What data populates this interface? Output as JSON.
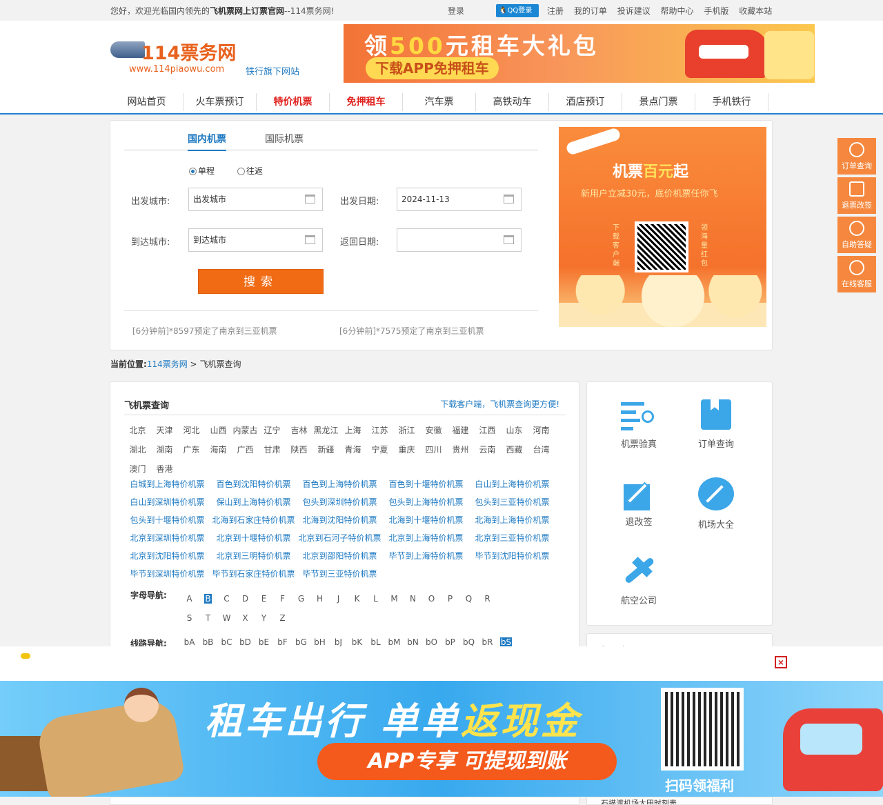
{
  "topbar": {
    "welcome_prefix": "您好，欢迎光临国内领先的",
    "welcome_bold": "飞机票网上订票官网",
    "welcome_suffix": "--114票务网!",
    "login": "登录",
    "qq_login": "QQ登录",
    "links": [
      "注册",
      "我的订单",
      "投诉建议",
      "帮助中心",
      "手机版",
      "收藏本站"
    ]
  },
  "header": {
    "logo_name": "114票务网",
    "logo_url": "www.114piaowu.com",
    "logo_flag": "铁行旗下网站",
    "banner_line1_a": "领",
    "banner_line1_num": "500",
    "banner_line1_b": "元租车大礼包",
    "banner_line2": "下载APP免押租车"
  },
  "nav": [
    {
      "label": "网站首页",
      "red": false
    },
    {
      "label": "火车票预订",
      "red": false
    },
    {
      "label": "特价机票",
      "red": true
    },
    {
      "label": "免押租车",
      "red": true
    },
    {
      "label": "汽车票",
      "red": false
    },
    {
      "label": "高铁动车",
      "red": false
    },
    {
      "label": "酒店预订",
      "red": false
    },
    {
      "label": "景点门票",
      "red": false
    },
    {
      "label": "手机铁行",
      "red": false
    }
  ],
  "search": {
    "tab_domestic": "国内机票",
    "tab_international": "国际机票",
    "radio_oneway": "单程",
    "radio_roundtrip": "往返",
    "from_label": "出发城市:",
    "from_value": "出发城市",
    "to_label": "到达城市:",
    "to_value": "到达城市",
    "depart_label": "出发日期:",
    "depart_value": "2024-11-13",
    "return_label": "返回日期:",
    "return_value": "",
    "button": "搜索",
    "recent": [
      "[6分钟前]*8597预定了南京到三亚机票",
      "[6分钟前]*7575预定了南京到三亚机票"
    ]
  },
  "promo": {
    "line1_a": "机票",
    "line1_b": "百元",
    "line1_c": "起",
    "line2": "新用户立减30元，底价机票任你飞",
    "left_vertical": "下载客户端",
    "right_vertical": "领海量红包"
  },
  "breadcrumb": {
    "label": "当前位置:",
    "home": "114票务网",
    "sep": ">",
    "current": "飞机票查询"
  },
  "main": {
    "title": "飞机票查询",
    "download": "下载客户端，飞机票查询更方便!",
    "provinces": [
      "北京",
      "天津",
      "河北",
      "山西",
      "内蒙古",
      "辽宁",
      "吉林",
      "黑龙江",
      "上海",
      "江苏",
      "浙江",
      "安徽",
      "福建",
      "江西",
      "山东",
      "河南",
      "湖北",
      "湖南",
      "广东",
      "海南",
      "广西",
      "甘肃",
      "陕西",
      "新疆",
      "青海",
      "宁夏",
      "重庆",
      "四川",
      "贵州",
      "云南",
      "西藏",
      "台湾",
      "澳门",
      "香港"
    ],
    "routes": [
      "白城到上海特价机票",
      "百色到沈阳特价机票",
      "百色到上海特价机票",
      "百色到十堰特价机票",
      "白山到上海特价机票",
      "白山到深圳特价机票",
      "保山到上海特价机票",
      "包头到深圳特价机票",
      "包头到上海特价机票",
      "包头到三亚特价机票",
      "包头到十堰特价机票",
      "北海到石家庄特价机票",
      "北海到沈阳特价机票",
      "北海到十堰特价机票",
      "北海到上海特价机票",
      "北京到深圳特价机票",
      "北京到十堰特价机票",
      "北京到石河子特价机票",
      "北京到上海特价机票",
      "北京到三亚特价机票",
      "北京到沈阳特价机票",
      "北京到三明特价机票",
      "北京到邵阳特价机票",
      "毕节到上海特价机票",
      "毕节到沈阳特价机票",
      "毕节到深圳特价机票",
      "毕节到石家庄特价机票",
      "毕节到三亚特价机票"
    ],
    "letters_label": "字母导航:",
    "letters": [
      "A",
      "B",
      "C",
      "D",
      "E",
      "F",
      "G",
      "H",
      "J",
      "K",
      "L",
      "M",
      "N",
      "O",
      "P",
      "Q",
      "R",
      "S",
      "T",
      "W",
      "X",
      "Y",
      "Z"
    ],
    "letters_selected": "B",
    "lines_label": "线路导航:",
    "lines": [
      "bA",
      "bB",
      "bC",
      "bD",
      "bE",
      "bF",
      "bG",
      "bH",
      "bJ",
      "bK",
      "bL",
      "bM",
      "bN",
      "bO",
      "bP",
      "bQ",
      "bR",
      "bS"
    ],
    "lines_selected": "bS"
  },
  "services": [
    {
      "label": "机票验真",
      "icon": "ticket-verify-icon"
    },
    {
      "label": "订单查询",
      "icon": "order-book-icon"
    },
    {
      "label": "退改签",
      "icon": "edit-icon"
    },
    {
      "label": "机场大全",
      "icon": "compass-icon"
    },
    {
      "label": "航空公司",
      "icon": "airplane-icon"
    }
  ],
  "side_info": {
    "title": "机票资讯",
    "last_item": "石描渡机场大田时刻表"
  },
  "float_menu": [
    {
      "label": "订单查询",
      "icon": "search-icon"
    },
    {
      "label": "退票改签",
      "icon": "ticket-icon"
    },
    {
      "label": "自助答疑",
      "icon": "headset-icon"
    },
    {
      "label": "在线客服",
      "icon": "chat-icon"
    }
  ],
  "bottom_ad": {
    "headline_a": "租车出行 单单",
    "headline_b": "返现金",
    "pill": "APP专享 可提现到账",
    "scan": "扫码领福利",
    "close": "×"
  }
}
